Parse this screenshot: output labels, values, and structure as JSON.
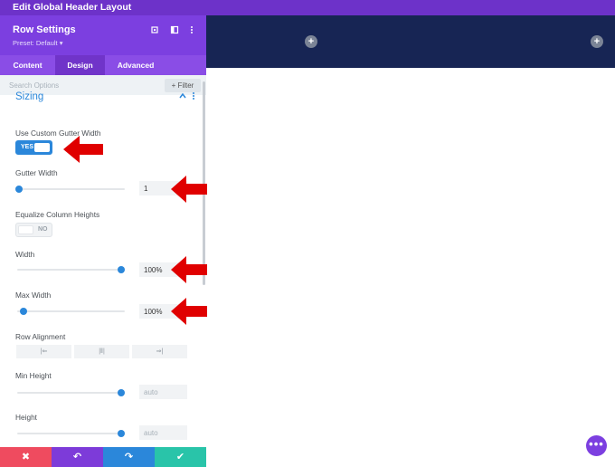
{
  "window": {
    "title": "Edit Global Header Layout"
  },
  "panel": {
    "title": "Row Settings",
    "preset": "Preset: Default ▾",
    "icons": [
      "expand-icon",
      "columns-icon",
      "more-vertical-icon"
    ]
  },
  "tabs": [
    {
      "label": "Content",
      "active": false
    },
    {
      "label": "Design",
      "active": true
    },
    {
      "label": "Advanced",
      "active": false
    }
  ],
  "search": {
    "placeholder": "Search Options",
    "filter_label": "+ Filter"
  },
  "section": {
    "title": "Sizing"
  },
  "fields": {
    "custom_gutter": {
      "label": "Use Custom Gutter Width",
      "toggle_text": "YES",
      "enabled": true
    },
    "gutter_width": {
      "label": "Gutter Width",
      "value": "1",
      "slider_fraction": 0.02
    },
    "equalize": {
      "label": "Equalize Column Heights",
      "toggle_text": "NO",
      "enabled": false
    },
    "width": {
      "label": "Width",
      "value": "100%",
      "slider_fraction": 0.97
    },
    "max_width": {
      "label": "Max Width",
      "value": "100%",
      "slider_fraction": 0.06
    },
    "row_alignment": {
      "label": "Row Alignment",
      "options": [
        "|⇐",
        "|‖|",
        "⇒|"
      ]
    },
    "min_height": {
      "label": "Min Height",
      "placeholder": "auto",
      "slider_fraction": 0.97
    },
    "height": {
      "label": "Height",
      "placeholder": "auto",
      "slider_fraction": 0.97
    }
  },
  "bottom_bar": {
    "cancel": "✖",
    "undo": "↶",
    "redo": "↷",
    "save": "✔"
  },
  "colors": {
    "purple": "#7c3fe0",
    "blue": "#2b87da",
    "cancel": "#ef4b5f",
    "undo": "#7d3bd9",
    "redo": "#2b87da",
    "save": "#29c4a9",
    "header_row": "#172554",
    "arrow": "#e00000"
  },
  "canvas": {
    "add_symbol": "+",
    "fab_symbol": "•••"
  }
}
